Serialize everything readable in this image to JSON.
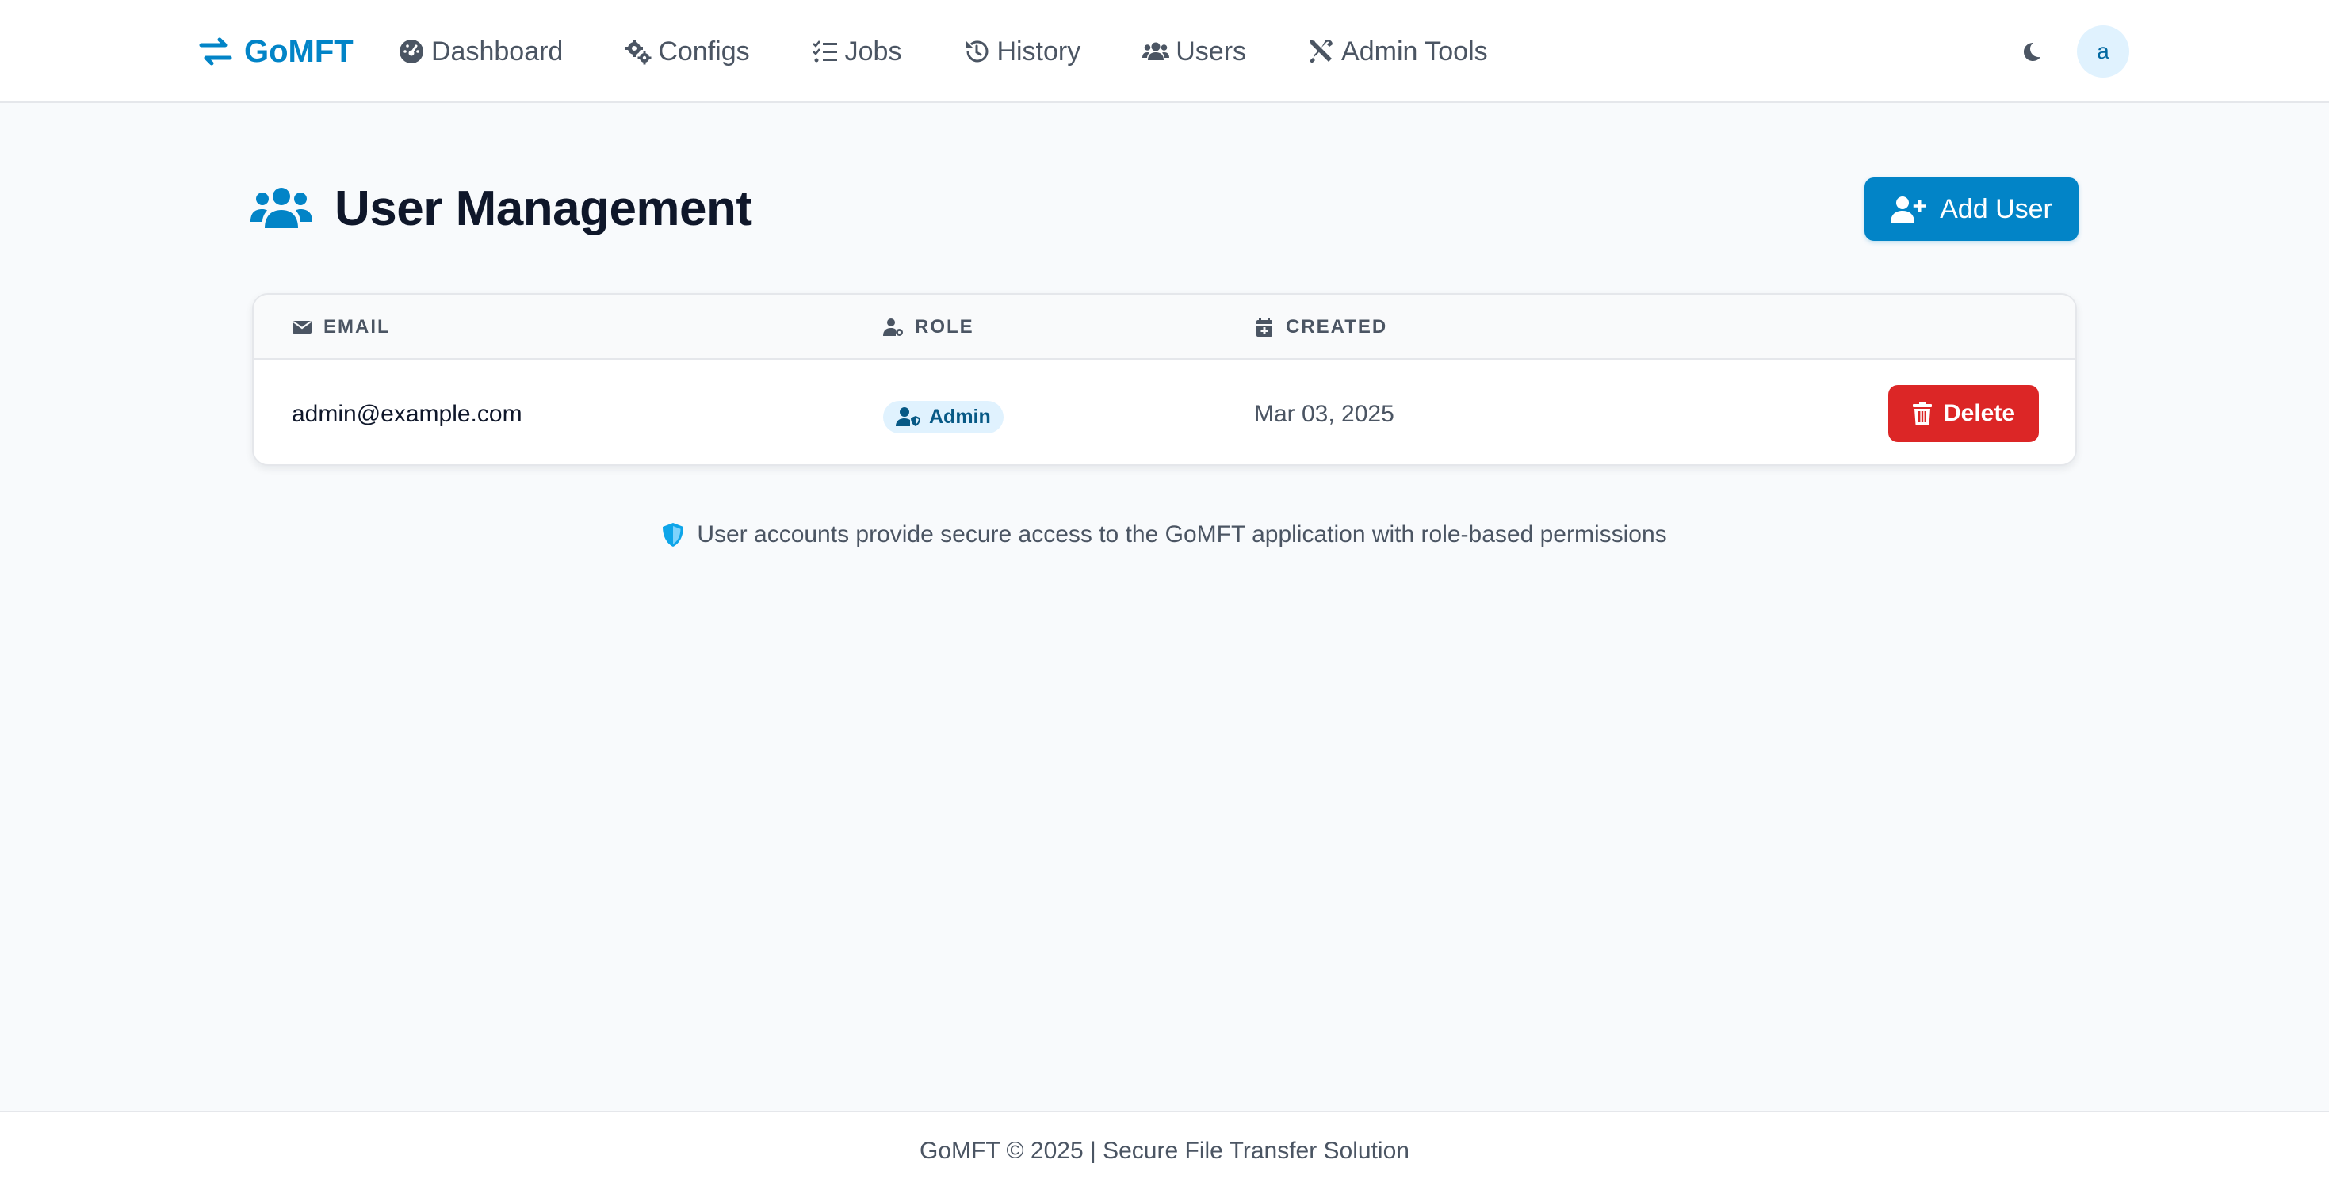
{
  "app": {
    "brand": "GoMFT",
    "brand_color": "#0284c7"
  },
  "nav": {
    "items": [
      {
        "label": "Dashboard",
        "icon": "gauge-icon"
      },
      {
        "label": "Configs",
        "icon": "gears-icon"
      },
      {
        "label": "Jobs",
        "icon": "list-check-icon"
      },
      {
        "label": "History",
        "icon": "history-icon"
      },
      {
        "label": "Users",
        "icon": "users-icon"
      },
      {
        "label": "Admin Tools",
        "icon": "tools-icon"
      }
    ],
    "theme_icon": "moon-icon",
    "avatar_initial": "a"
  },
  "page": {
    "title": "User Management",
    "title_icon": "users-icon",
    "add_button": "Add User"
  },
  "table": {
    "columns": [
      {
        "label": "EMAIL",
        "icon": "envelope-icon"
      },
      {
        "label": "ROLE",
        "icon": "user-gear-icon"
      },
      {
        "label": "CREATED",
        "icon": "calendar-icon"
      }
    ],
    "rows": [
      {
        "email": "admin@example.com",
        "role": "Admin",
        "created": "Mar 03, 2025",
        "action": "Delete"
      }
    ]
  },
  "info": {
    "text": "User accounts provide secure access to the GoMFT application with role-based permissions",
    "icon": "shield-icon"
  },
  "footer": {
    "text": "GoMFT © 2025 | Secure File Transfer Solution"
  },
  "colors": {
    "primary": "#0284c7",
    "danger": "#dc2626",
    "badge_bg": "#e0f2fe",
    "background": "#f8fafc"
  }
}
